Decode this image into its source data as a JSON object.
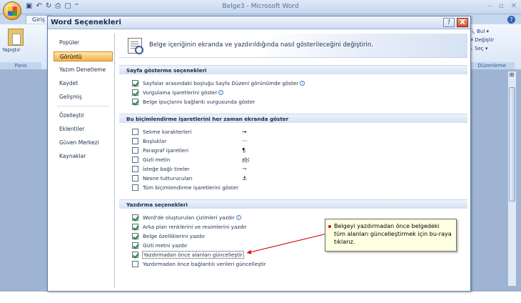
{
  "word": {
    "title": "Belge3 - Microsoft Word",
    "tab_home": "Giriş",
    "paste_label": "Yapıştır",
    "clipboard_group": "Pano",
    "find_label": "Bul",
    "replace_label": "Değiştir",
    "select_label": "Seç",
    "editing_group": "Düzenleme"
  },
  "dialog": {
    "title": "Word Seçenekleri",
    "help_label": "?",
    "close_label": "X"
  },
  "nav": {
    "items": [
      {
        "label": "Popüler"
      },
      {
        "label": "Görüntü"
      },
      {
        "label": "Yazım Denetleme"
      },
      {
        "label": "Kaydet"
      },
      {
        "label": "Gelişmiş"
      },
      {
        "label": "Özelleştir"
      },
      {
        "label": "Eklentiler"
      },
      {
        "label": "Güven Merkezi"
      },
      {
        "label": "Kaynaklar"
      }
    ],
    "selected": "Görüntü"
  },
  "banner": {
    "text": "Belge içeriğinin ekranda ve yazdırıldığında nasıl gösterileceğini değiştirin."
  },
  "sections": {
    "page_display": {
      "header": "Sayfa gösterme seçenekleri",
      "options": [
        {
          "label": "Sayfalar arasındaki boşluğu Sayfa Düzeni görünümde göster",
          "checked": true
        },
        {
          "label": "Vurgulama işaretlerini göster",
          "checked": true
        },
        {
          "label": "Belge ipuçlarını bağlantı vurgusunda göster",
          "checked": true
        }
      ]
    },
    "formatting_marks": {
      "header": "Bu biçimlendirme işaretlerini her zaman ekranda göster",
      "options": [
        {
          "label": "Sekme karakterleri",
          "symbol": "→",
          "checked": false
        },
        {
          "label": "Boşluklar",
          "symbol": "···",
          "checked": false
        },
        {
          "label": "Paragraf işaretleri",
          "symbol": "¶",
          "checked": false
        },
        {
          "label": "Gizli metin",
          "symbol": "abc",
          "checked": false
        },
        {
          "label": "İsteğe bağlı tireler",
          "symbol": "¬",
          "checked": false
        },
        {
          "label": "Nesne tutturucuları",
          "symbol": "⚓",
          "checked": false
        },
        {
          "label": "Tüm biçimlendirme işaretlerini göster",
          "symbol": "",
          "checked": false
        }
      ]
    },
    "printing": {
      "header": "Yazdırma seçenekleri",
      "options": [
        {
          "label": "Word'de oluşturulan çizimleri yazdır",
          "checked": true
        },
        {
          "label": "Arka plan renklerini ve resimlerini yazdır",
          "checked": true
        },
        {
          "label": "Belge özelliklerini yazdır",
          "checked": true
        },
        {
          "label": "Gizli metni yazdır",
          "checked": true
        },
        {
          "label": "Yazdırmadan önce alanları güncelleştir",
          "checked": true
        },
        {
          "label": "Yazdırmadan önce bağlantılı verileri güncelleştir",
          "checked": false
        }
      ]
    }
  },
  "callout": {
    "text": "Belgeyi yazdırmadan önce belgedeki tüm alanları güncelleştirmek için bu-raya tıklarız."
  },
  "colors": {
    "accent": "#f6b24c",
    "callout_bg": "#ffffe1",
    "arrow": "#d00000"
  }
}
